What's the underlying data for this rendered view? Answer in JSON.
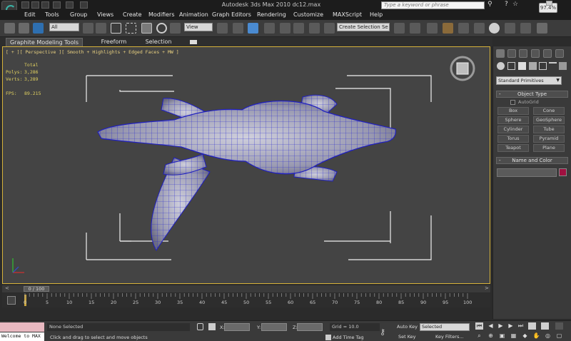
{
  "window": {
    "title": "Autodesk 3ds Max  2010      dc12.max",
    "search_placeholder": "Type a keyword or phrase",
    "memory_badge": "97.4%"
  },
  "menu": [
    "Edit",
    "Tools",
    "Group",
    "Views",
    "Create",
    "Modifiers",
    "Animation",
    "Graph Editors",
    "Rendering",
    "Customize",
    "MAXScript",
    "Help"
  ],
  "toolbar": {
    "selection_filter": "All",
    "reference_coord": "View",
    "named_selection": "Create Selection Se"
  },
  "ribbon": {
    "tabs": [
      "Graphite Modeling Tools",
      "Freeform",
      "Selection"
    ]
  },
  "viewport": {
    "label": "[ + ][ Perspective ][ Smooth + Highlights + Edged Faces + MW ]",
    "stats_total": "Total",
    "polys_label": "Polys:",
    "polys_value": "3,286",
    "verts_label": "Verts:",
    "verts_value": "3,289",
    "fps_label": "FPS:",
    "fps_value": "89.215"
  },
  "command_panel": {
    "category_dropdown": "Standard Primitives",
    "object_type_title": "Object Type",
    "autogrid_label": "AutoGrid",
    "object_buttons": [
      "Box",
      "Cone",
      "Sphere",
      "GeoSphere",
      "Cylinder",
      "Tube",
      "Torus",
      "Pyramid",
      "Teapot",
      "Plane"
    ],
    "name_color_title": "Name and Color",
    "object_color": "#a01040"
  },
  "timeline": {
    "slider_label": "0 / 100",
    "frames": [
      "0",
      "5",
      "10",
      "15",
      "20",
      "25",
      "30",
      "35",
      "40",
      "45",
      "50",
      "55",
      "60",
      "65",
      "70",
      "75",
      "80",
      "85",
      "90",
      "95",
      "100"
    ]
  },
  "status": {
    "maxscript_output": "Welcome to MAX",
    "selection": "None Selected",
    "prompt": "Click and drag to select and move objects",
    "x_label": "X:",
    "y_label": "Y:",
    "z_label": "Z:",
    "grid": "Grid = 10.0",
    "add_time_tag": "Add Time Tag",
    "auto_key": "Auto Key",
    "set_key": "Set Key",
    "key_mode": "Selected",
    "key_filters": "Key Filters..."
  },
  "colors": {
    "viewport_bg": "#444444",
    "active_border": "#d6b23a",
    "wireframe": "#2828d0",
    "stats_text": "#e0d060"
  }
}
